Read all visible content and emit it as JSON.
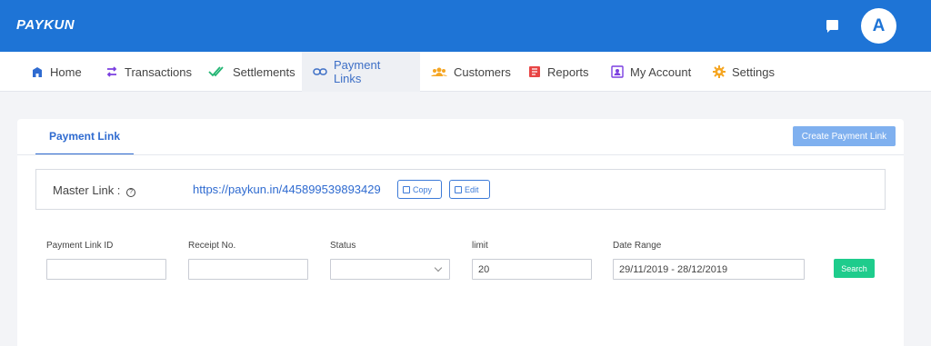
{
  "header": {
    "logo": "PAYKUN",
    "avatar_initial": "A"
  },
  "nav": {
    "home": "Home",
    "transactions": "Transactions",
    "settlements": "Settlements",
    "payment_links": "Payment Links",
    "customers": "Customers",
    "reports": "Reports",
    "my_account": "My Account",
    "settings": "Settings"
  },
  "page": {
    "tab": "Payment Link",
    "create_button": "Create Payment Link",
    "master_label": "Master Link :",
    "master_url": "https://paykun.in/445899539893429",
    "copy_label": "Copy",
    "edit_label": "Edit"
  },
  "filters": {
    "payment_link_id": {
      "label": "Payment Link ID",
      "value": ""
    },
    "receipt_no": {
      "label": "Receipt No.",
      "value": ""
    },
    "status": {
      "label": "Status",
      "value": ""
    },
    "limit": {
      "label": "limit",
      "value": "20"
    },
    "date_range": {
      "label": "Date Range",
      "value": "29/11/2019 - 28/12/2019"
    },
    "search_label": "Search"
  },
  "colors": {
    "primary": "#1e74d6",
    "accent_link": "#2f6bd0",
    "search": "#1ecc8c",
    "create": "#7fb0ef"
  }
}
